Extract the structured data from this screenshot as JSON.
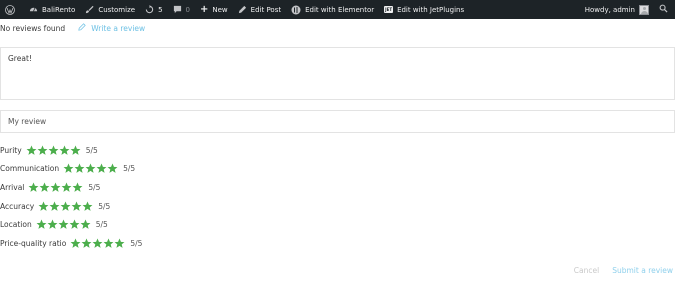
{
  "admin_bar": {
    "site_name": "BaliRento",
    "customize": "Customize",
    "updates_count": "5",
    "comments_count": "0",
    "new": "New",
    "edit_post": "Edit Post",
    "edit_elementor": "Edit with Elementor",
    "edit_jetplugins": "Edit with JetPlugins",
    "jet_badge": "JET",
    "greeting": "Howdy, admin"
  },
  "reviews": {
    "no_reviews_text": "No reviews found",
    "write_review_label": "Write a review",
    "review_text_value": "Great!",
    "review_title_value": "My review",
    "accent_color": "#4cae4c",
    "link_color": "#6ec1e4"
  },
  "ratings": [
    {
      "label": "Purity",
      "value_text": "5/5",
      "stars": 5
    },
    {
      "label": "Communication",
      "value_text": "5/5",
      "stars": 5
    },
    {
      "label": "Arrival",
      "value_text": "5/5",
      "stars": 5
    },
    {
      "label": "Accuracy",
      "value_text": "5/5",
      "stars": 5
    },
    {
      "label": "Location",
      "value_text": "5/5",
      "stars": 5
    },
    {
      "label": "Price-quality ratio",
      "value_text": "5/5",
      "stars": 5
    }
  ],
  "actions": {
    "cancel_label": "Cancel",
    "submit_label": "Submit a review"
  }
}
